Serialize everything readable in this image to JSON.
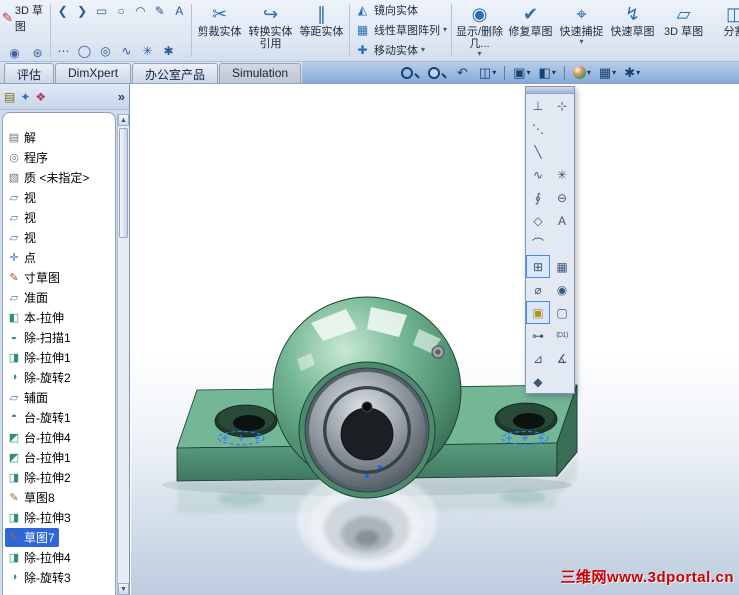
{
  "window": {
    "watermark": "三维网www.3dportal.cn"
  },
  "colors": {
    "selection_blue": "#2e66d9",
    "watermark_red": "#cc0000",
    "model_green": "#5f9f81",
    "tabbar_blue": "#9cbbe0"
  },
  "ribbon": {
    "sketch3d_label": "3D 草图",
    "sketch3d_glyph": "✎",
    "corner_tools": [
      {
        "name": "view-orientation-small-icon",
        "glyph": "◉"
      },
      {
        "name": "sketch-settings-icon",
        "glyph": "⊛"
      }
    ],
    "small_row1": [
      {
        "name": "back-icon",
        "glyph": "❮"
      },
      {
        "name": "forward-icon",
        "glyph": "❯"
      },
      {
        "name": "rectangle-tool-icon",
        "glyph": "▭"
      },
      {
        "name": "circle-tool-icon",
        "glyph": "○"
      },
      {
        "name": "arc-tool-icon",
        "glyph": "◠"
      },
      {
        "name": "pencil-tool-icon",
        "glyph": "✎"
      },
      {
        "name": "text-tool-icon",
        "glyph": "A"
      }
    ],
    "small_row2": [
      {
        "name": "dots-tool-icon",
        "glyph": "⋯"
      },
      {
        "name": "ellipse-tool-icon",
        "glyph": "◯"
      },
      {
        "name": "perimeter-circle-tool-icon",
        "glyph": "◎"
      },
      {
        "name": "spline-tool-icon",
        "glyph": "∿"
      },
      {
        "name": "point-tool-icon",
        "glyph": "✳"
      },
      {
        "name": "asterisk-tool-icon",
        "glyph": "✱"
      }
    ],
    "big_left": [
      {
        "name": "trim-entities-button",
        "label": "剪裁实体",
        "glyph": "✂",
        "dd": ""
      },
      {
        "name": "convert-entities-button",
        "label": "转换实体引用",
        "glyph": "↪",
        "dd": ""
      },
      {
        "name": "offset-entities-button",
        "label": "等距实体",
        "glyph": "∥",
        "dd": ""
      }
    ],
    "stacked": [
      {
        "name": "mirror-entities-button",
        "label": "镜向实体",
        "glyph": "◭",
        "dd": ""
      },
      {
        "name": "linear-sketch-pattern-button",
        "label": "线性草图阵列",
        "glyph": "▦",
        "dd": "▾"
      },
      {
        "name": "move-entities-button",
        "label": "移动实体",
        "glyph": "✚",
        "dd": "▾"
      }
    ],
    "big_right": [
      {
        "name": "display-delete-relations-button",
        "label": "显示/删除几...",
        "glyph": "◉",
        "dd": "▾"
      },
      {
        "name": "repair-sketch-button",
        "label": "修复草图",
        "glyph": "✔",
        "dd": ""
      },
      {
        "name": "quick-snaps-button",
        "label": "快速捕捉",
        "glyph": "⌖",
        "dd": "▾"
      },
      {
        "name": "rapid-sketch-button",
        "label": "快速草图",
        "glyph": "↯",
        "dd": ""
      },
      {
        "name": "sketch-3d-plane-button",
        "label": "3D 草图",
        "glyph": "▱",
        "dd": ""
      },
      {
        "name": "split-entities-button",
        "label": "分割",
        "glyph": "◫",
        "dd": ""
      }
    ]
  },
  "tabs": [
    {
      "name": "tab-evaluate",
      "label": "评估"
    },
    {
      "name": "tab-dimxpert",
      "label": "DimXpert"
    },
    {
      "name": "tab-office-products",
      "label": "办公室产品"
    },
    {
      "name": "tab-simulation",
      "label": "Simulation",
      "cls": "simtab"
    }
  ],
  "headsup": [
    {
      "name": "zoom-fit-icon",
      "glyph": "",
      "cls": "mag",
      "dd": ""
    },
    {
      "name": "zoom-area-icon",
      "glyph": "",
      "cls": "mag2",
      "dd": ""
    },
    {
      "name": "previous-view-icon",
      "glyph": "↶",
      "dd": ""
    },
    {
      "name": "section-view-icon",
      "glyph": "◫",
      "dd": "▾"
    },
    {
      "name": "headsup-separator-1",
      "glyph": "",
      "cls": "sep",
      "dd": ""
    },
    {
      "name": "view-orientation-icon",
      "glyph": "▣",
      "dd": "▾"
    },
    {
      "name": "display-style-icon",
      "glyph": "◧",
      "dd": "▾"
    },
    {
      "name": "headsup-separator-2",
      "glyph": "",
      "cls": "sep",
      "dd": ""
    },
    {
      "name": "appearances-icon",
      "glyph": "",
      "cls": "ball",
      "dd": "▾"
    },
    {
      "name": "scene-icon",
      "glyph": "▦",
      "dd": "▾"
    },
    {
      "name": "view-settings-icon",
      "glyph": "✱",
      "dd": "▾"
    }
  ],
  "panel": {
    "chevron": "»",
    "scroll_up": "▲",
    "scroll_down": "▼",
    "header_icons": [
      {
        "name": "featuremanager-tab-icon",
        "glyph": "▤"
      },
      {
        "name": "propertymanager-tab-icon",
        "glyph": "✦"
      },
      {
        "name": "configurationmanager-tab-icon",
        "glyph": "❖"
      }
    ]
  },
  "feature_tree": {
    "items": [
      {
        "label": "解",
        "glyph": "▤",
        "ic": "gray",
        "name": "tree-item-annotations"
      },
      {
        "label": "程序",
        "glyph": "◎",
        "ic": "gray",
        "name": "tree-item-program"
      },
      {
        "label": "质 <未指定>",
        "glyph": "▧",
        "ic": "gray",
        "name": "tree-item-material"
      },
      {
        "label": "视",
        "glyph": "▱",
        "ic": "blue",
        "name": "tree-item-plane-1"
      },
      {
        "label": "视",
        "glyph": "▱",
        "ic": "blue",
        "name": "tree-item-plane-2"
      },
      {
        "label": "视",
        "glyph": "▱",
        "ic": "blue",
        "name": "tree-item-plane-3"
      },
      {
        "label": "点",
        "glyph": "✛",
        "ic": "blue",
        "name": "tree-item-origin"
      },
      {
        "label": "寸草图",
        "glyph": "✎",
        "ic": "red",
        "name": "tree-item-layout-sketch"
      },
      {
        "label": "准面",
        "glyph": "▱",
        "ic": "blue",
        "name": "tree-item-ref-plane"
      },
      {
        "label": "本-拉伸",
        "glyph": "◧",
        "ic": "teal",
        "name": "tree-item-boss-extrude"
      },
      {
        "label": "除-扫描1",
        "glyph": "◒",
        "ic": "teal",
        "name": "tree-item-cut-sweep1"
      },
      {
        "label": "除-拉伸1",
        "glyph": "◨",
        "ic": "teal",
        "name": "tree-item-cut-extrude1"
      },
      {
        "label": "除-旋转2",
        "glyph": "◑",
        "ic": "teal",
        "name": "tree-item-cut-revolve2"
      },
      {
        "label": "辅面",
        "glyph": "▱",
        "ic": "blue",
        "name": "tree-item-aux-plane"
      },
      {
        "label": "台-旋转1",
        "glyph": "◓",
        "ic": "teal",
        "name": "tree-item-boss-revolve1"
      },
      {
        "label": "台-拉伸4",
        "glyph": "◩",
        "ic": "teal",
        "name": "tree-item-boss-extrude4"
      },
      {
        "label": "台-拉伸1",
        "glyph": "◩",
        "ic": "teal",
        "name": "tree-item-boss-extrude1"
      },
      {
        "label": "除-拉伸2",
        "glyph": "◨",
        "ic": "teal",
        "name": "tree-item-cut-extrude2"
      },
      {
        "label": "草图8",
        "glyph": "✎",
        "ic": "brown",
        "name": "tree-item-sketch8"
      },
      {
        "label": "除-拉伸3",
        "glyph": "◨",
        "ic": "teal",
        "name": "tree-item-cut-extrude3"
      },
      {
        "label": "草图7",
        "glyph": "✎",
        "ic": "brown",
        "selected": true,
        "name": "tree-item-sketch7"
      },
      {
        "label": "除-拉伸4",
        "glyph": "◨",
        "ic": "teal",
        "name": "tree-item-cut-extrude4"
      },
      {
        "label": "除-旋转3",
        "glyph": "◑",
        "ic": "teal",
        "name": "tree-item-cut-revolve3"
      }
    ]
  },
  "palette": {
    "cells": [
      {
        "name": "snap-axis-icon",
        "glyph": "⊥"
      },
      {
        "name": "snap-move-icon",
        "glyph": "⊹"
      },
      {
        "name": "snap-sketch-line-icon",
        "glyph": "⋱"
      },
      {
        "name": "palette-blank-1",
        "glyph": ""
      },
      {
        "name": "snap-centerline-icon",
        "glyph": "╲"
      },
      {
        "name": "palette-blank-2",
        "glyph": ""
      },
      {
        "name": "snap-spline-icon",
        "glyph": "∿"
      },
      {
        "name": "snap-point-icon",
        "glyph": "✳"
      },
      {
        "name": "snap-spring-icon",
        "glyph": "∮"
      },
      {
        "name": "snap-disable-icon",
        "glyph": "⊖"
      },
      {
        "name": "snap-check-icon",
        "glyph": "◇"
      },
      {
        "name": "snap-text-icon",
        "glyph": "A"
      },
      {
        "name": "snap-curve-icon",
        "glyph": "⌒"
      },
      {
        "name": "palette-blank-3",
        "glyph": ""
      },
      {
        "name": "snap-grid-axis-icon",
        "glyph": "⊞",
        "selected": true
      },
      {
        "name": "snap-grid-icon",
        "glyph": "▦"
      },
      {
        "name": "snap-diameter-icon",
        "glyph": "⌀"
      },
      {
        "name": "snap-visibility-icon",
        "glyph": "◉"
      },
      {
        "name": "snap-cylinder-icon",
        "glyph": "▣",
        "selected": true,
        "cls": "gold"
      },
      {
        "name": "snap-rectangle-icon",
        "glyph": "▢"
      },
      {
        "name": "snap-connector-icon",
        "glyph": "⊶"
      },
      {
        "name": "snap-dimension-d1-icon",
        "glyph": "(D1)",
        "cls": "txt"
      },
      {
        "name": "snap-triangle-icon",
        "glyph": "⊿"
      },
      {
        "name": "snap-angle-icon",
        "glyph": "∡"
      },
      {
        "name": "snap-shield-icon",
        "glyph": "◆"
      },
      {
        "name": "palette-blank-4",
        "glyph": ""
      }
    ]
  }
}
